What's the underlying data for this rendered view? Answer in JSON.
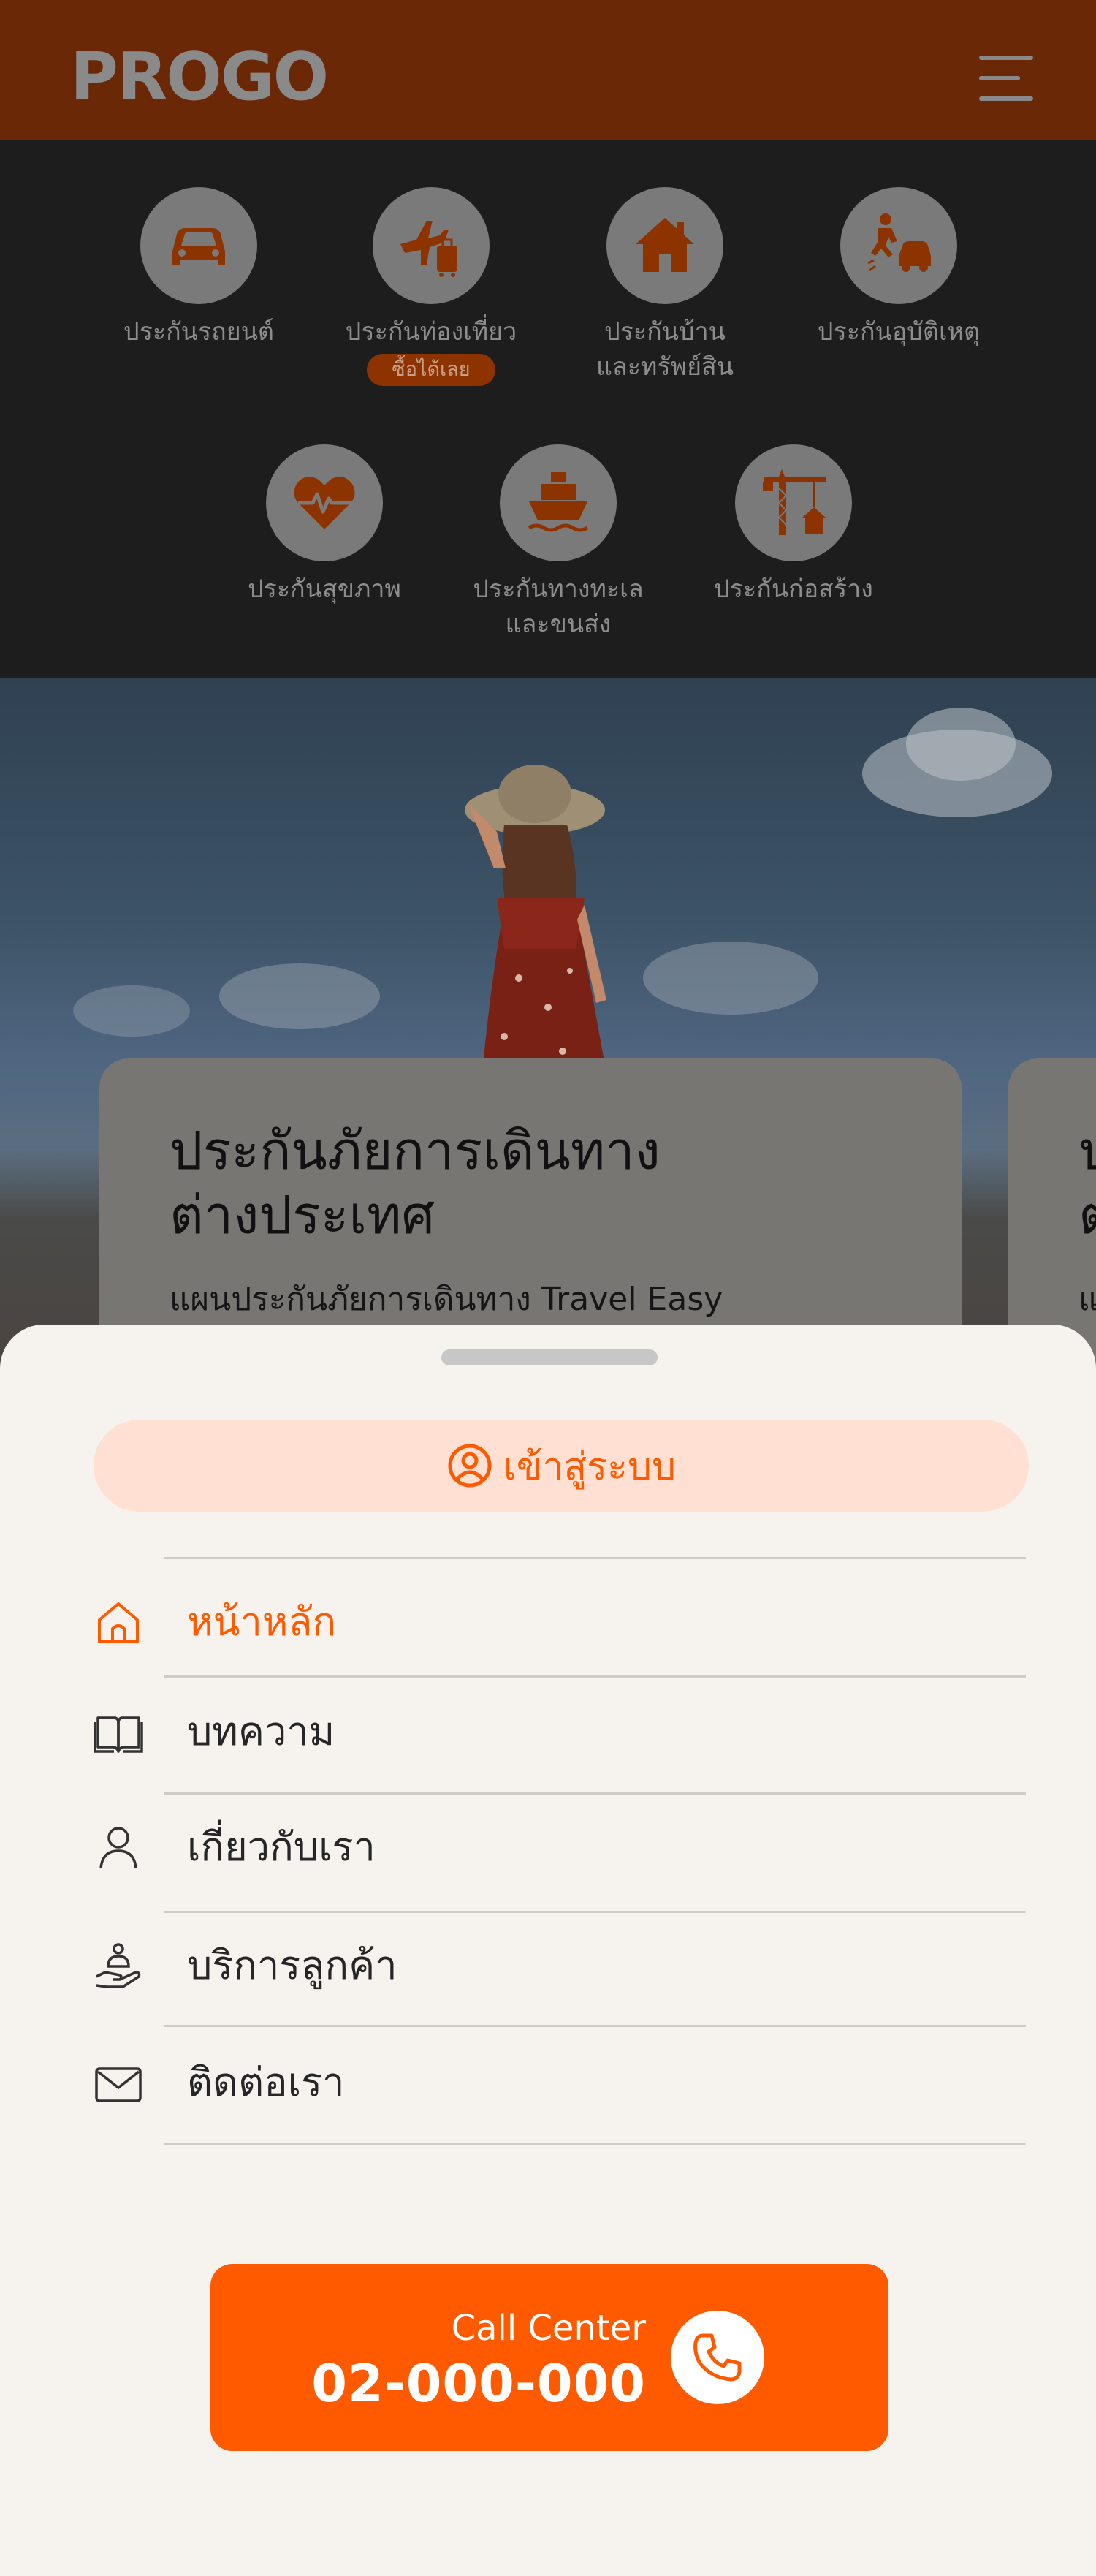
{
  "header": {
    "logo": "PROGO",
    "menu_icon": "hamburger-icon"
  },
  "categories": [
    {
      "label": "ประกันรถยนต์",
      "icon": "car-icon"
    },
    {
      "label": "ประกันท่องเที่ยว",
      "icon": "travel-plane-luggage-icon",
      "badge": "ซื้อได้เลย"
    },
    {
      "label": "ประกันบ้าน\nและทรัพย์สิน",
      "icon": "house-icon"
    },
    {
      "label": "ประกันอุบัติเหตุ",
      "icon": "accident-icon"
    },
    {
      "label": "ประกันสุขภาพ",
      "icon": "heart-pulse-icon"
    },
    {
      "label": "ประกันทางทะเล\nและขนส่ง",
      "icon": "ship-icon"
    },
    {
      "label": "ประกันก่อสร้าง",
      "icon": "construction-crane-icon"
    }
  ],
  "hero": {
    "card_title_line1": "ประกันภัยการเดินทาง",
    "card_title_line2": "ต่างประเทศ",
    "card_subtitle": "แผนประกันภัยการเดินทาง Travel Easy",
    "next_card_title_line1": "ป",
    "next_card_title_line2": "ต",
    "next_card_subtitle": "แ"
  },
  "sheet": {
    "login_label": "เข้าสู่ระบบ",
    "login_icon": "user-circle-icon",
    "menu": [
      {
        "label": "หน้าหลัก",
        "icon": "home-icon",
        "active": true
      },
      {
        "label": "บทความ",
        "icon": "book-open-icon",
        "active": false
      },
      {
        "label": "เกี่ยวกับเรา",
        "icon": "user-icon",
        "active": false
      },
      {
        "label": "บริการลูกค้า",
        "icon": "hand-service-icon",
        "active": false
      },
      {
        "label": "ติดต่อเรา",
        "icon": "mail-icon",
        "active": false
      }
    ],
    "call_center_label": "Call Center",
    "call_center_number": "02-000-000",
    "call_icon": "phone-icon"
  },
  "colors": {
    "header_bg": "#6a2806",
    "accent": "#ff5a00",
    "login_bg": "#ffe0d2",
    "sheet_bg": "#f6f2ed",
    "dark_overlay": "#1d1d1d"
  }
}
